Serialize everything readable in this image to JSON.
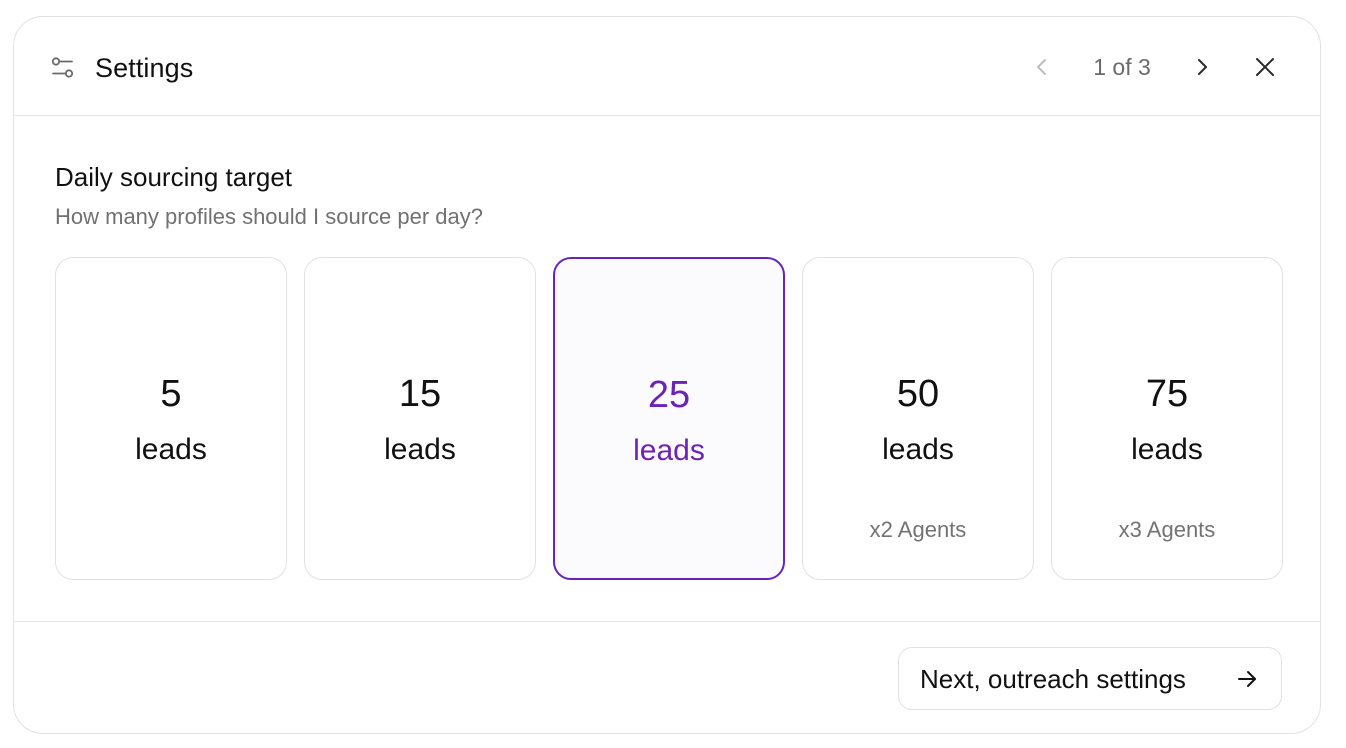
{
  "header": {
    "title": "Settings",
    "pager": "1 of 3"
  },
  "section": {
    "title": "Daily sourcing target",
    "subtitle": "How many profiles should I source per day?"
  },
  "options": [
    {
      "value": "5",
      "unit": "leads",
      "note": "",
      "selected": false
    },
    {
      "value": "15",
      "unit": "leads",
      "note": "",
      "selected": false
    },
    {
      "value": "25",
      "unit": "leads",
      "note": "",
      "selected": true
    },
    {
      "value": "50",
      "unit": "leads",
      "note": "x2 Agents",
      "selected": false
    },
    {
      "value": "75",
      "unit": "leads",
      "note": "x3 Agents",
      "selected": false
    }
  ],
  "footer": {
    "next_label": "Next, outreach settings"
  },
  "colors": {
    "accent": "#6a22b8",
    "muted_text": "#717171",
    "border": "#e1e1e4"
  },
  "icons": {
    "header": "sliders-icon",
    "prev": "chevron-left-icon",
    "next": "chevron-right-icon",
    "close": "close-icon",
    "button": "arrow-right-icon"
  }
}
